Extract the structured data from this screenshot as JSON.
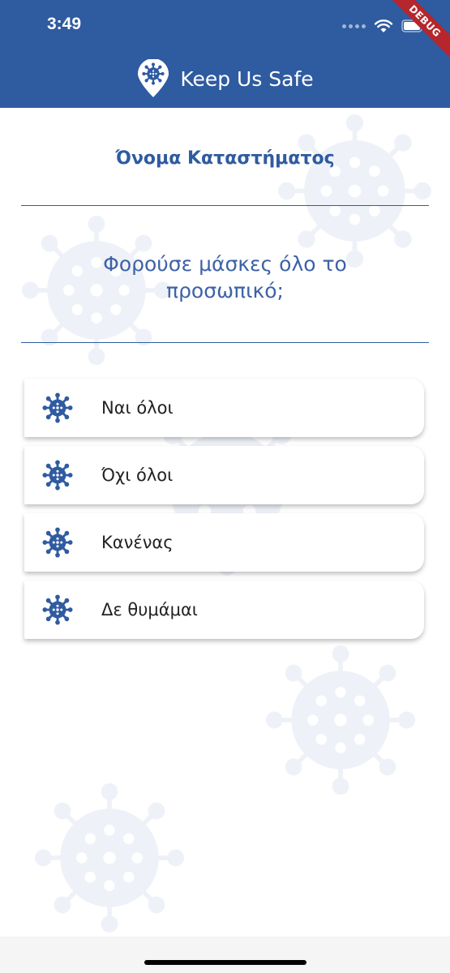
{
  "status_bar": {
    "time": "3:49",
    "debug_label": "DEBUG"
  },
  "app_bar": {
    "title": "Keep Us Safe",
    "logo_icon": "virus-location-pin-icon"
  },
  "store": {
    "name": "Όνομα Καταστήματος"
  },
  "question": {
    "text": "Φορούσε μάσκες όλο το προσωπικό;"
  },
  "options": [
    {
      "label": "Ναι όλοι",
      "icon": "virus-icon"
    },
    {
      "label": "Όχι όλοι",
      "icon": "virus-icon"
    },
    {
      "label": "Κανένας",
      "icon": "virus-icon"
    },
    {
      "label": "Δε θυμάμαι",
      "icon": "virus-icon"
    }
  ],
  "colors": {
    "primary": "#2f5ba0",
    "background_virus": "#eef2f8",
    "debug_ribbon": "#b5262d"
  }
}
